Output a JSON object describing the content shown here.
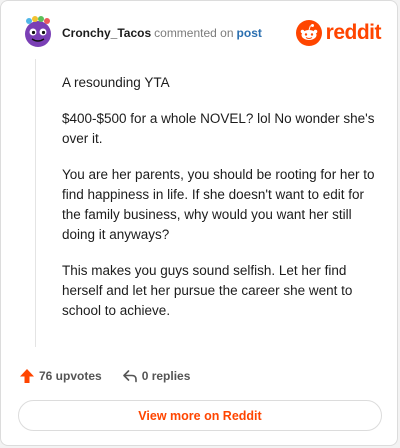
{
  "header": {
    "username": "Cronchy_Tacos",
    "action_text": "commented on",
    "post_link": "post",
    "brand": "reddit"
  },
  "comment": {
    "paragraphs": [
      "A resounding YTA",
      "$400-$500 for a whole NOVEL? lol No wonder she's over it.",
      "You are her parents, you should be rooting for her to find happiness in life. If she doesn't want to edit for the family business, why would you want her still doing it anyways?",
      "This makes you guys sound selfish. Let her find herself and let her pursue the career she went to school to achieve."
    ]
  },
  "actions": {
    "upvotes": "76 upvotes",
    "replies": "0 replies"
  },
  "footer": {
    "view_more": "View more on Reddit"
  },
  "colors": {
    "brand": "#ff4500",
    "link": "#2a6fb0",
    "avatar_bg": "#7a3fb5"
  }
}
